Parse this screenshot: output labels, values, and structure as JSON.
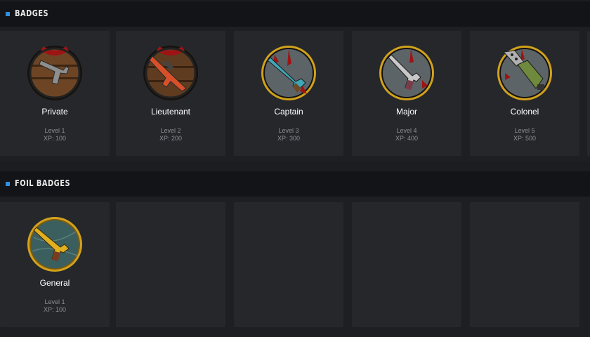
{
  "badges_section": {
    "title": "BADGES",
    "items": [
      {
        "name": "Private",
        "level": "Level 1",
        "xp": "XP: 100",
        "icon": "pistol-medal-icon"
      },
      {
        "name": "Lieutenant",
        "level": "Level 2",
        "xp": "XP: 200",
        "icon": "rifle-medal-icon"
      },
      {
        "name": "Captain",
        "level": "Level 3",
        "xp": "XP: 300",
        "icon": "shotgun-medal-icon"
      },
      {
        "name": "Major",
        "level": "Level 4",
        "xp": "XP: 400",
        "icon": "revolver-medal-icon"
      },
      {
        "name": "Colonel",
        "level": "Level 5",
        "xp": "XP: 500",
        "icon": "launcher-medal-icon"
      }
    ]
  },
  "foil_section": {
    "title": "FOIL BADGES",
    "items": [
      {
        "name": "General",
        "level": "Level 1",
        "xp": "XP: 100",
        "icon": "golden-revolver-medal-icon"
      }
    ]
  },
  "colors": {
    "accent": "#2f8fe0",
    "header_bg": "#131417",
    "card_bg": "#26272b",
    "gold_rim": "#d2a21c",
    "blood": "#9e1414"
  }
}
